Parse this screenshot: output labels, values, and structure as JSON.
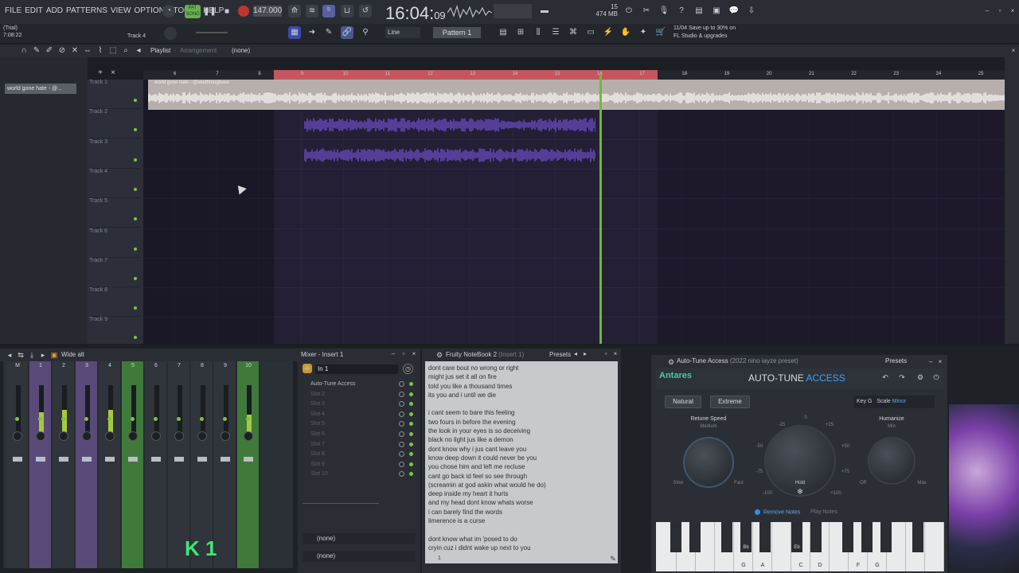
{
  "menu": [
    "FILE",
    "EDIT",
    "ADD",
    "PATTERNS",
    "VIEW",
    "OPTIONS",
    "TOOLS",
    "HELP"
  ],
  "transport": {
    "mode": "SONG",
    "pat": "PAT",
    "tempo": "147.000",
    "time": "16:04",
    "time_sub": "09"
  },
  "stats": {
    "ram": "474 MB",
    "cores": "15",
    "val2": "1"
  },
  "hint": {
    "line1": "11/04  Save up to 30% on",
    "line2": "FL Studio & upgrades"
  },
  "status": {
    "trial": "(Trial)",
    "time": "7:08:22",
    "hint_track": "Track 4"
  },
  "toolbar": {
    "snap": "Line",
    "pattern": "Pattern 1"
  },
  "playlist": {
    "title": "Playlist",
    "sep": "-",
    "subtitle": "Arrangement",
    "selection": "(none)",
    "clip_name": "world gone hate - @...",
    "clip_label": "world gone hate - @seethroughsee",
    "tracks": [
      "Track 1",
      "Track 2",
      "Track 3",
      "Track 4",
      "Track 5",
      "Track 6",
      "Track 7",
      "Track 8",
      "Track 9"
    ],
    "bars": [
      "6",
      "7",
      "8",
      "9",
      "10",
      "11",
      "12",
      "13",
      "14",
      "15",
      "16",
      "17",
      "18",
      "19",
      "20",
      "21",
      "22",
      "23",
      "24",
      "25"
    ]
  },
  "mixer": {
    "view": "Wide alt",
    "strips": [
      "M",
      "1",
      "2",
      "3",
      "4",
      "5",
      "6",
      "7",
      "8",
      "9",
      "10"
    ],
    "overlay": "1"
  },
  "insert": {
    "title": "Mixer - Insert 1",
    "input": "In 1",
    "slots": [
      "Auto-Tune Access",
      "Slot 2",
      "Slot 3",
      "Slot 4",
      "Slot 5",
      "Slot 6",
      "Slot 7",
      "Slot 8",
      "Slot 9",
      "Slot 10"
    ],
    "out1": "(none)",
    "out2": "(none)"
  },
  "notebook": {
    "title": "Fruity NoteBook 2",
    "subtitle": "(Insert 1)",
    "presets": "Presets",
    "text": "dont care bout no wrong or right\nmight jus set it all on fire\ntold you like a thousand times\nits you and i until we die\n\ni cant seem to bare this feeling\ntwo fours in before the evening\nthe look in your eyes is so deceiving\nblack no light jus like a demon\ndont know why i jus cant leave you\nknow deep down it could never be you\nyou chose him and left me recluse\ncant go back id feel so see through\n(screamin at god askin what would he do)\ndeep inside my heart it hurts\nand my head dont know whats worse\ni can barely find the words\nlimerence is a curse\n\ndont know what im 'posed to do\ncryin cuz i didnt wake up next to you",
    "page": "1"
  },
  "autotune": {
    "title": "Auto-Tune Access",
    "preset": "(2022 nino iayze preset)",
    "presets": "Presets",
    "brand": "Antares",
    "product1": "AUTO-TUNE",
    "product2": "ACCESS",
    "natural": "Natural",
    "extreme": "Extreme",
    "key_label": "Key",
    "key_value": "G",
    "scale_label": "Scale",
    "scale_value": "Minor",
    "retune": "Retune Speed",
    "retune_sub": "Medium",
    "slow": "Slow",
    "fast": "Fast",
    "humanize": "Humanize",
    "humanize_sub": "Min",
    "off": "Off",
    "max": "Max",
    "hold": "Hold",
    "dial_ticks": [
      "0",
      "-25",
      "+25",
      "-50",
      "+50",
      "-75",
      "+75",
      "-100",
      "+100"
    ],
    "remove_notes": "Remove Notes",
    "play_notes": "Play Notes",
    "white_keys": [
      "",
      "",
      "",
      "",
      "G",
      "A",
      "",
      "C",
      "D",
      "",
      "F",
      "G",
      "",
      "",
      ""
    ],
    "black_keys": [
      "",
      "",
      "",
      "Bb",
      "",
      "Eb",
      "",
      "",
      "",
      "",
      ""
    ]
  }
}
